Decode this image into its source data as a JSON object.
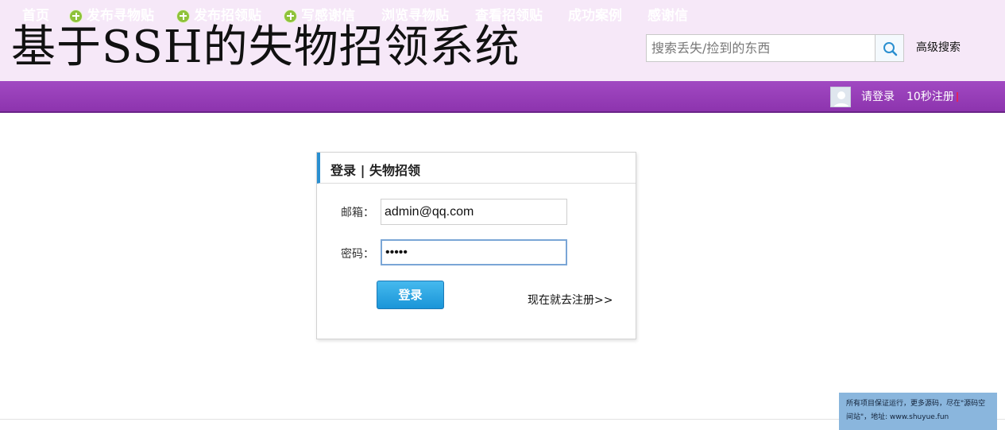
{
  "header": {
    "title": "基于SSH的失物招领系统",
    "search_placeholder": "搜索丢失/捡到的东西",
    "advanced_search": "高级搜索"
  },
  "nav": {
    "home": "首页",
    "publish_lost": "发布寻物贴",
    "publish_found": "发布招领贴",
    "write_thanks": "写感谢信",
    "browse_lost": "浏览寻物贴",
    "view_found": "查看招领贴",
    "success_cases": "成功案例",
    "thanks_letters": "感谢信",
    "login": "请登录",
    "register": "10秒注册"
  },
  "login_panel": {
    "title": "登录 | 失物招领",
    "email_label": "邮箱：",
    "email_value": "admin@qq.com",
    "password_label": "密码：",
    "password_value": "•••••",
    "login_button": "登录",
    "register_link": "现在就去注册>>"
  },
  "notice": {
    "text": "所有项目保证运行，更多源码，尽在\"源码空间站\"，地址: www.shuyue.fun"
  },
  "colors": {
    "nav_bg": "#9b42bc",
    "header_bg": "#f6e8f8",
    "accent_blue": "#2a8fd0",
    "notice_bg": "#8ab6dd"
  }
}
